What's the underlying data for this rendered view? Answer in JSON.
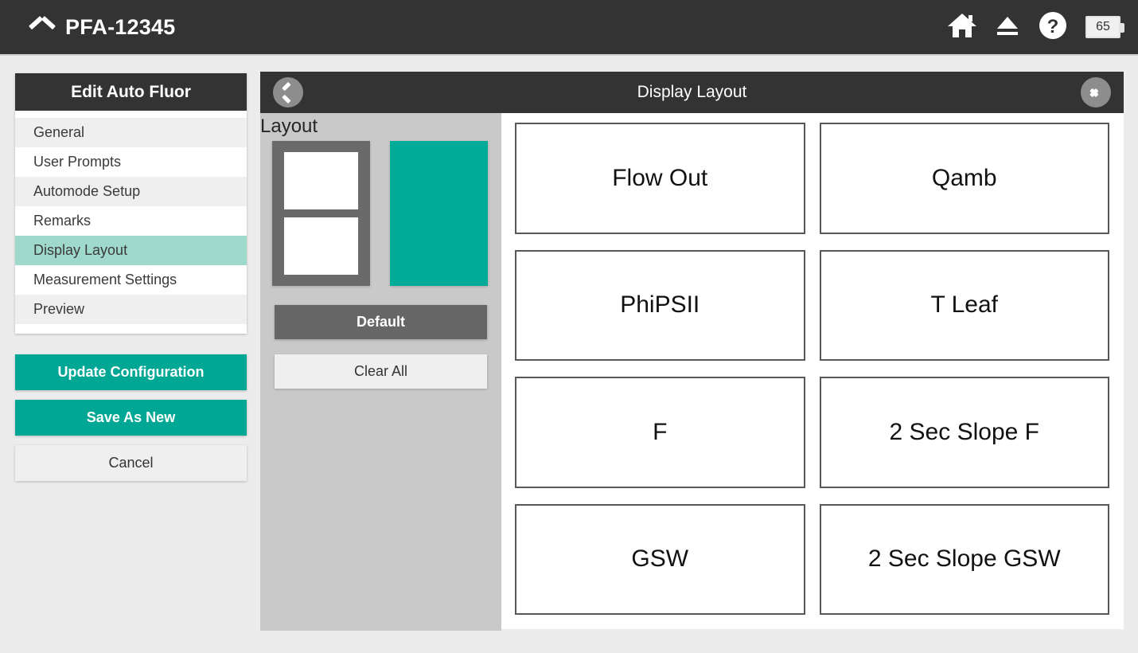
{
  "titlebar": {
    "collapse_icon": "chevron-up-icon",
    "device_name": "PFA-12345",
    "icons": [
      {
        "name": "home-icon",
        "glyph": "home"
      },
      {
        "name": "eject-icon",
        "glyph": "eject"
      },
      {
        "name": "help-icon",
        "glyph": "question-circle"
      }
    ],
    "battery": {
      "icon": "battery-icon",
      "level": "65"
    }
  },
  "sidebar": {
    "header": "Edit Auto Fluor",
    "items": [
      {
        "label": "General",
        "active": false
      },
      {
        "label": "User Prompts",
        "active": false
      },
      {
        "label": "Automode Setup",
        "active": false
      },
      {
        "label": "Remarks",
        "active": false
      },
      {
        "label": "Display Layout",
        "active": true
      },
      {
        "label": "Measurement Settings",
        "active": false
      },
      {
        "label": "Preview",
        "active": false
      }
    ],
    "buttons": {
      "update": "Update Configuration",
      "save_as_new": "Save As New",
      "cancel": "Cancel"
    }
  },
  "main": {
    "title": "Display Layout",
    "prev_arrow": "previous-page-arrow",
    "next_arrow": "next-page-arrow"
  },
  "layout_panel": {
    "label": "Layout",
    "options": [
      {
        "name": "layout-1x2",
        "rows": 2,
        "cols": 1,
        "selected": false
      },
      {
        "name": "layout-4x2",
        "rows": 4,
        "cols": 2,
        "selected": true
      }
    ],
    "buttons": {
      "default": "Default",
      "clear_all": "Clear All"
    }
  },
  "display_grid": {
    "rows": 4,
    "cols": 2,
    "cells": [
      "Flow Out",
      "Qamb",
      "PhiPSII",
      "T Leaf",
      "F",
      "2 Sec Slope F",
      "GSW",
      "2 Sec Slope GSW"
    ]
  },
  "colors": {
    "accent_teal": "#00a795",
    "accent_teal_light": "#9ed9cc",
    "dark_chrome": "#333333",
    "panel_gray": "#c9c9c9",
    "page_bg": "#ececec"
  }
}
